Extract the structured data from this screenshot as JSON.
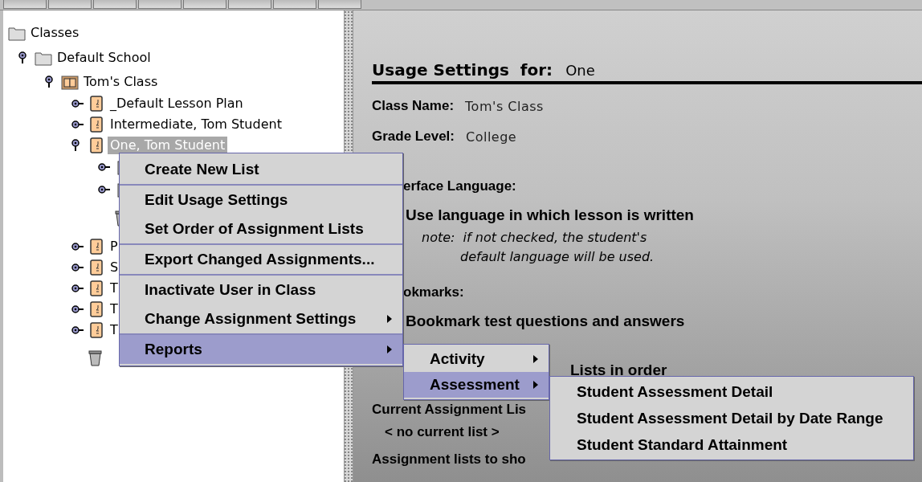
{
  "tree": {
    "label": "Classes",
    "kind": "folder",
    "children": [
      {
        "label": "Default School",
        "kind": "folder",
        "expanded": true,
        "children": [
          {
            "label": "Tom's Class",
            "kind": "class",
            "expanded": true,
            "children": [
              {
                "label": "_Default Lesson Plan",
                "kind": "student",
                "expanded": false,
                "selected": false
              },
              {
                "label": "Intermediate, Tom Student",
                "kind": "student",
                "expanded": false,
                "selected": false
              },
              {
                "label": "One, Tom Student",
                "kind": "student",
                "expanded": true,
                "selected": true,
                "children": [
                  {
                    "kind": "list",
                    "expanded": false
                  },
                  {
                    "kind": "list",
                    "expanded": false
                  },
                  {
                    "kind": "trash"
                  }
                ]
              },
              {
                "label": "P",
                "kind": "student",
                "expanded": false,
                "selected": false
              },
              {
                "label": "S",
                "kind": "student",
                "expanded": false,
                "selected": false
              },
              {
                "label": "T",
                "kind": "student",
                "expanded": false,
                "selected": false
              },
              {
                "label": "T",
                "kind": "student",
                "expanded": false,
                "selected": false
              },
              {
                "label": "T",
                "kind": "student",
                "expanded": false,
                "selected": false
              },
              {
                "kind": "trash"
              }
            ]
          }
        ]
      }
    ]
  },
  "settings": {
    "title": "Usage Settings  for:",
    "subject": "One",
    "fields": [
      {
        "label": "Class Name:",
        "value": "Tom's Class"
      },
      {
        "label": "Grade Level:",
        "value": "College"
      }
    ],
    "rows": [
      {
        "kind": "section",
        "text": "erface Language:"
      },
      {
        "kind": "option",
        "text": "Use language in which lesson is written"
      },
      {
        "kind": "note",
        "text": "note:  if not checked, the student's"
      },
      {
        "kind": "note2",
        "text": "default language will be used."
      },
      {
        "kind": "section",
        "text": "okmarks:"
      },
      {
        "kind": "option",
        "text": "Bookmark test questions and answers"
      },
      {
        "kind": "option-far",
        "text": "Lists in order"
      },
      {
        "kind": "heading",
        "text": "Current Assignment Lis"
      },
      {
        "kind": "value",
        "text": "< no current list >"
      },
      {
        "kind": "heading2",
        "text": "Assignment lists to sho"
      }
    ]
  },
  "context_menu": [
    {
      "label": "Create New List",
      "separator_before": false,
      "submenu": false,
      "selected": false
    },
    {
      "label": "Edit Usage Settings",
      "separator_before": true,
      "submenu": false,
      "selected": false
    },
    {
      "label": "Set Order of Assignment Lists",
      "separator_before": false,
      "submenu": false,
      "selected": false
    },
    {
      "label": "Export Changed Assignments...",
      "separator_before": true,
      "submenu": false,
      "selected": false
    },
    {
      "label": "Inactivate User in Class",
      "separator_before": true,
      "submenu": false,
      "selected": false
    },
    {
      "label": "Change Assignment Settings",
      "separator_before": false,
      "submenu": true,
      "selected": false
    },
    {
      "label": "Reports",
      "separator_before": true,
      "submenu": true,
      "selected": true
    }
  ],
  "reports_menu": [
    {
      "label": "Activity",
      "submenu": true,
      "selected": false
    },
    {
      "label": "Assessment",
      "submenu": true,
      "selected": true
    }
  ],
  "assessment_menu": [
    {
      "label": "Student Assessment Detail",
      "selected": false
    },
    {
      "label": "Student Assessment Detail by Date Range",
      "selected": false
    },
    {
      "label": "Student Standard Attainment",
      "selected": false
    }
  ]
}
